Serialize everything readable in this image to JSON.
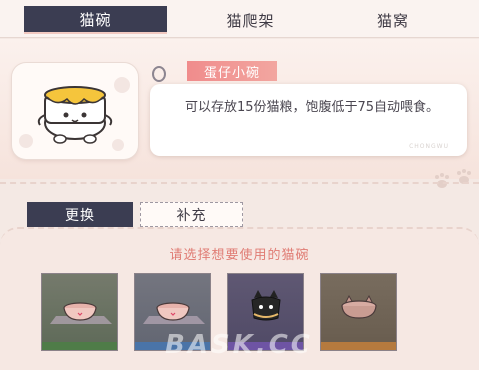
{
  "tabs": [
    {
      "label": "猫碗",
      "active": true
    },
    {
      "label": "猫爬架",
      "active": false
    },
    {
      "label": "猫窝",
      "active": false
    }
  ],
  "item": {
    "name": "蛋仔小碗",
    "description": "可以存放15份猫粮，饱腹低于75自动喂食。",
    "card_mark": "CHONGWU"
  },
  "sub_tabs": [
    {
      "label": "更换",
      "active": true
    },
    {
      "label": "补充",
      "active": false
    }
  ],
  "prompt": "请选择想要使用的猫碗",
  "bowls": [
    {
      "icon": "pink-bowl-icon",
      "bg": "#6e7464",
      "base": "#4f7c48"
    },
    {
      "icon": "pink-bowl-icon",
      "bg": "#6b6e78",
      "base": "#4a74a8"
    },
    {
      "icon": "black-cat-bowl-icon",
      "bg": "#57506b",
      "base": "#6e54a4"
    },
    {
      "icon": "cat-ear-bowl-icon",
      "bg": "#6e6355",
      "base": "#b57a3e"
    }
  ],
  "watermark": "BASK.CC",
  "colors": {
    "accent_dark": "#3b3d52",
    "tag_pink": "#f08c8c",
    "prompt_text": "#e07c74"
  }
}
